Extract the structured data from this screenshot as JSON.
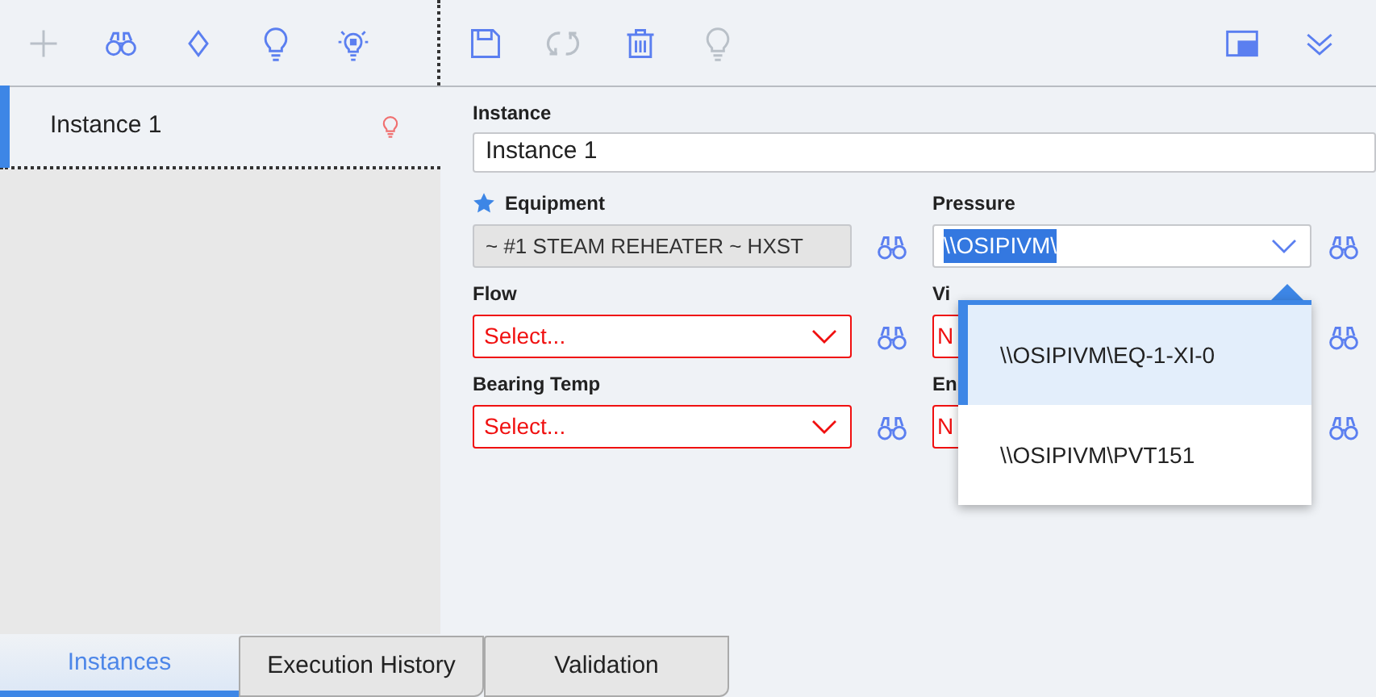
{
  "toolbar": {
    "left_icons": [
      {
        "kind": "add",
        "disabled": true
      },
      {
        "kind": "search",
        "disabled": false
      },
      {
        "kind": "sort",
        "disabled": false
      },
      {
        "kind": "bulb",
        "disabled": false
      },
      {
        "kind": "bulb-glow",
        "disabled": false
      }
    ],
    "right_icons": [
      {
        "kind": "save",
        "disabled": false
      },
      {
        "kind": "refresh",
        "disabled": true
      },
      {
        "kind": "delete",
        "disabled": false
      },
      {
        "kind": "bulb",
        "disabled": true
      }
    ],
    "end_icons": [
      {
        "kind": "layout",
        "disabled": false
      },
      {
        "kind": "collapse",
        "disabled": false
      }
    ]
  },
  "instances": [
    {
      "label": "Instance 1",
      "selected": true
    }
  ],
  "form": {
    "instance": {
      "label": "Instance",
      "value": "Instance 1"
    },
    "fields": [
      {
        "label": "Equipment",
        "kind": "readonly",
        "value": "~ #1 STEAM REHEATER ~ HXST",
        "required": true,
        "invalid": false
      },
      {
        "label": "Pressure",
        "kind": "select",
        "value": "\\\\OSIPIVM\\",
        "value_highlighted": true,
        "invalid": false
      },
      {
        "label": "Flow",
        "kind": "select",
        "placeholder": "Select...",
        "invalid": true
      },
      {
        "label": "Vi",
        "kind": "select_covered",
        "placeholder": "N",
        "invalid": true
      },
      {
        "label": "Bearing Temp",
        "kind": "select",
        "placeholder": "Select...",
        "invalid": true
      },
      {
        "label": "En",
        "kind": "select_covered",
        "placeholder": "N",
        "invalid": true
      }
    ]
  },
  "dropdown": {
    "options": [
      {
        "label": "\\\\OSIPIVM\\EQ-1-XI-0",
        "selected": true
      },
      {
        "label": "\\\\OSIPIVM\\PVT151",
        "selected": false
      }
    ]
  },
  "tabs": [
    {
      "label": "Instances",
      "selected": true
    },
    {
      "label": "Execution History",
      "selected": false
    },
    {
      "label": "Validation",
      "selected": false
    }
  ]
}
